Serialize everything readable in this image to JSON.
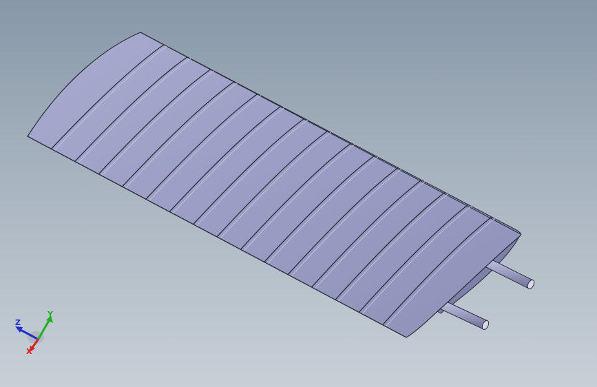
{
  "viewport": {
    "background_top": "#8797a8",
    "background_bottom": "#c8d0d7"
  },
  "model": {
    "name": "wing-section",
    "surface_color": "#9fa2c6",
    "edge_color": "#2a2c3a",
    "rib_count": 15,
    "tube_count": 2
  },
  "triad": {
    "x_label": "X",
    "y_label": "Y",
    "z_label": "Z",
    "x_color": "#d62020",
    "y_color": "#22b022",
    "z_color": "#2030c8"
  }
}
